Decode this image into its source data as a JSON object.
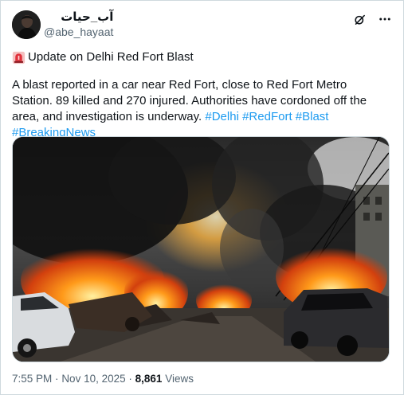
{
  "author": {
    "display_name": "آب_حیات",
    "handle": "@abe_hayaat"
  },
  "actions": {
    "grok_icon": "grok-icon",
    "more_icon": "more-icon"
  },
  "post": {
    "update_text": "Update on Delhi Red Fort Blast",
    "body_text": "A blast reported in a car near Red Fort, close to Red Fort Metro Station. 89 killed and 270 injured. Authorities have cordoned off the area, and investigation is underway.",
    "hashtags": [
      "#Delhi",
      "#RedFort",
      "#Blast",
      "#BreakingNews"
    ]
  },
  "footer": {
    "time": "7:55 PM",
    "separator": "·",
    "date": "Nov 10, 2025",
    "views_count": "8,861",
    "views_label": "Views"
  },
  "colors": {
    "link": "#1d9bf0",
    "secondary_text": "#536471",
    "border": "#cfd9de"
  }
}
